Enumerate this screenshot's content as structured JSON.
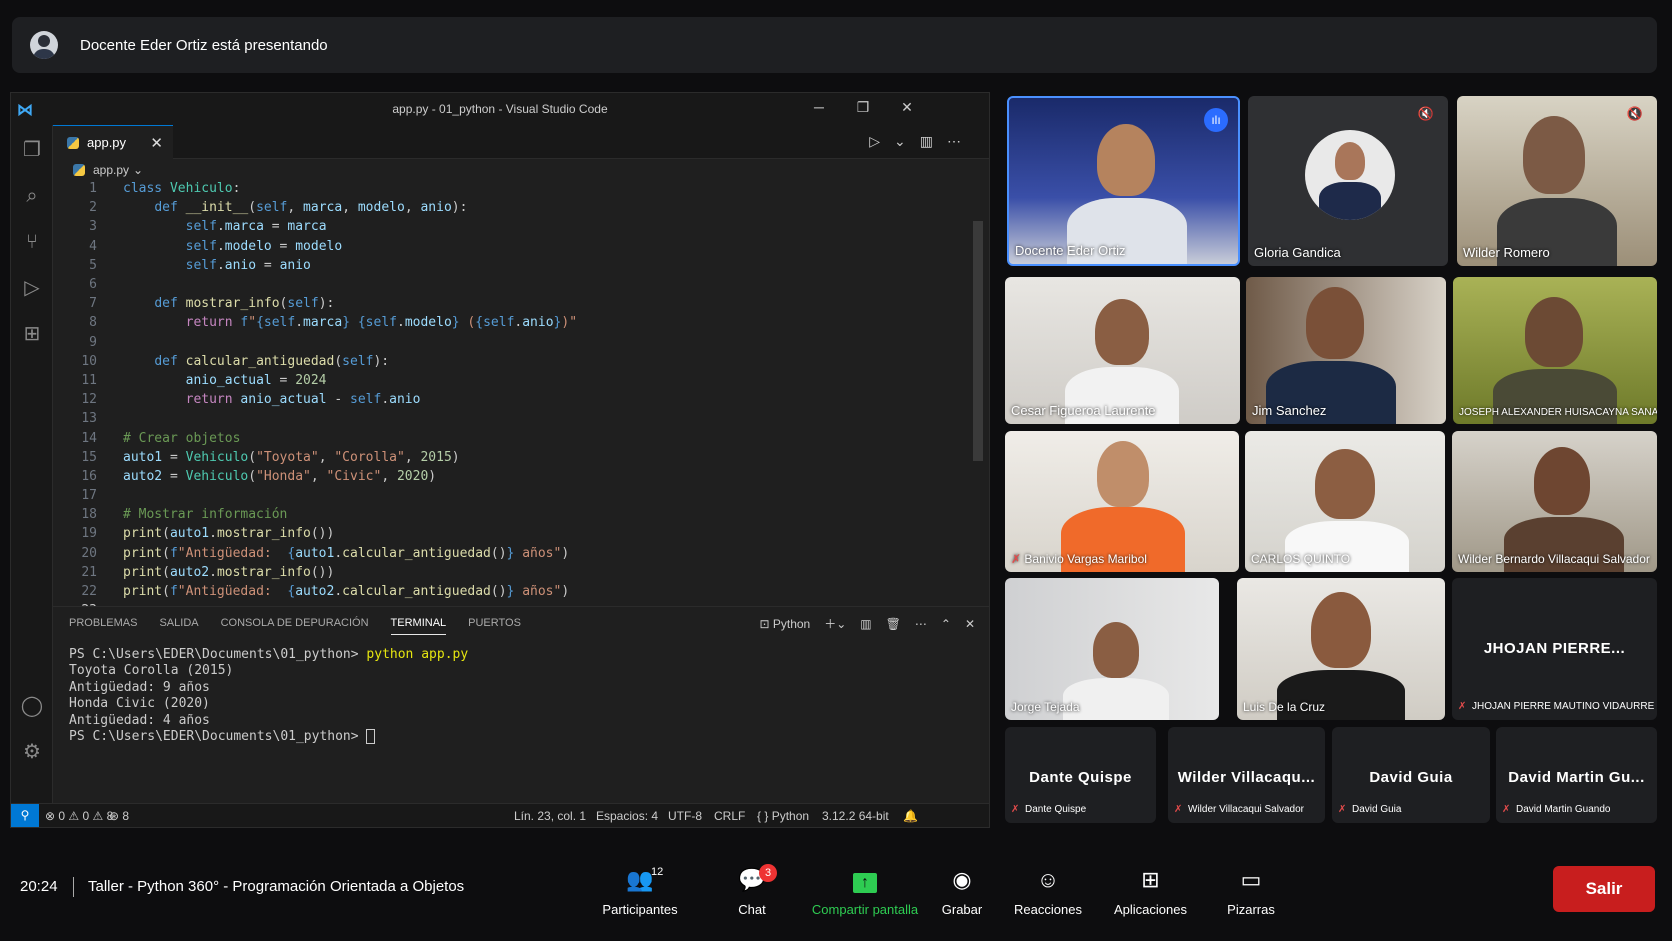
{
  "banner": {
    "text": "Docente Eder Ortiz está presentando"
  },
  "vscode": {
    "title": "app.py - 01_python - Visual Studio Code",
    "tab": "app.py",
    "breadcrumb": "app.py",
    "panel_tabs": [
      "PROBLEMAS",
      "SALIDA",
      "CONSOLA DE DEPURACIÓN",
      "TERMINAL",
      "PUERTOS"
    ],
    "terminal_shell": "Python",
    "terminal_prompt": "PS C:\\Users\\EDER\\Documents\\01_python>",
    "terminal_cmd": "python app.py",
    "terminal_output": [
      "Toyota Corolla (2015)",
      "Antigüedad: 9 años",
      "Honda Civic (2020)",
      "Antigüedad: 4 años"
    ],
    "status": {
      "errors": "⊗ 0 ⚠ 0 ⚠ 8",
      "ports": "⊛ 8",
      "position": "Lín. 23, col. 1",
      "spaces": "Espacios: 4",
      "encoding": "UTF-8",
      "eol": "CRLF",
      "language": "Python",
      "interpreter": "3.12.2 64-bit"
    }
  },
  "participants": [
    {
      "name": "Docente Eder Ortiz"
    },
    {
      "name": "Gloria Gandica"
    },
    {
      "name": "Wilder Romero"
    },
    {
      "name": "Cesar Figueroa Laurente"
    },
    {
      "name": "Jim Sanchez"
    },
    {
      "name": "JOSEPH ALEXANDER HUISACAYNA SANA"
    },
    {
      "name": "Banivio Vargas Maribol"
    },
    {
      "name": "CARLOS QUINTO"
    },
    {
      "name": "Wilder Bernardo Villacaqui Salvador"
    },
    {
      "name": "Jorge Tejada"
    },
    {
      "name": "Luis De la Cruz"
    }
  ],
  "name_tiles": [
    {
      "big": "JHOJAN  PIERRE...",
      "small": "JHOJAN PIERRE MAUTINO VIDAURRE"
    },
    {
      "big": "Dante Quispe",
      "small": "Dante Quispe"
    },
    {
      "big": "Wilder  Villacaqu...",
      "small": "Wilder Villacaqui Salvador"
    },
    {
      "big": "David Guia",
      "small": "David Guia"
    },
    {
      "big": "David Martin Gu...",
      "small": "David Martin Guando"
    }
  ],
  "bottom": {
    "time": "20:24",
    "meeting": "Taller - Python 360° - Programación Orientada a Objetos",
    "participants_label": "Participantes",
    "participants_count": "12",
    "chat_label": "Chat",
    "chat_badge": "3",
    "share_label": "Compartir pantalla",
    "record_label": "Grabar",
    "reactions_label": "Reacciones",
    "apps_label": "Aplicaciones",
    "whiteboard_label": "Pizarras",
    "leave_label": "Salir"
  },
  "colors": {
    "accent": "#0078d4",
    "leave": "#c81e1e",
    "share": "#2ecc52",
    "speaking": "#4a90ff"
  }
}
